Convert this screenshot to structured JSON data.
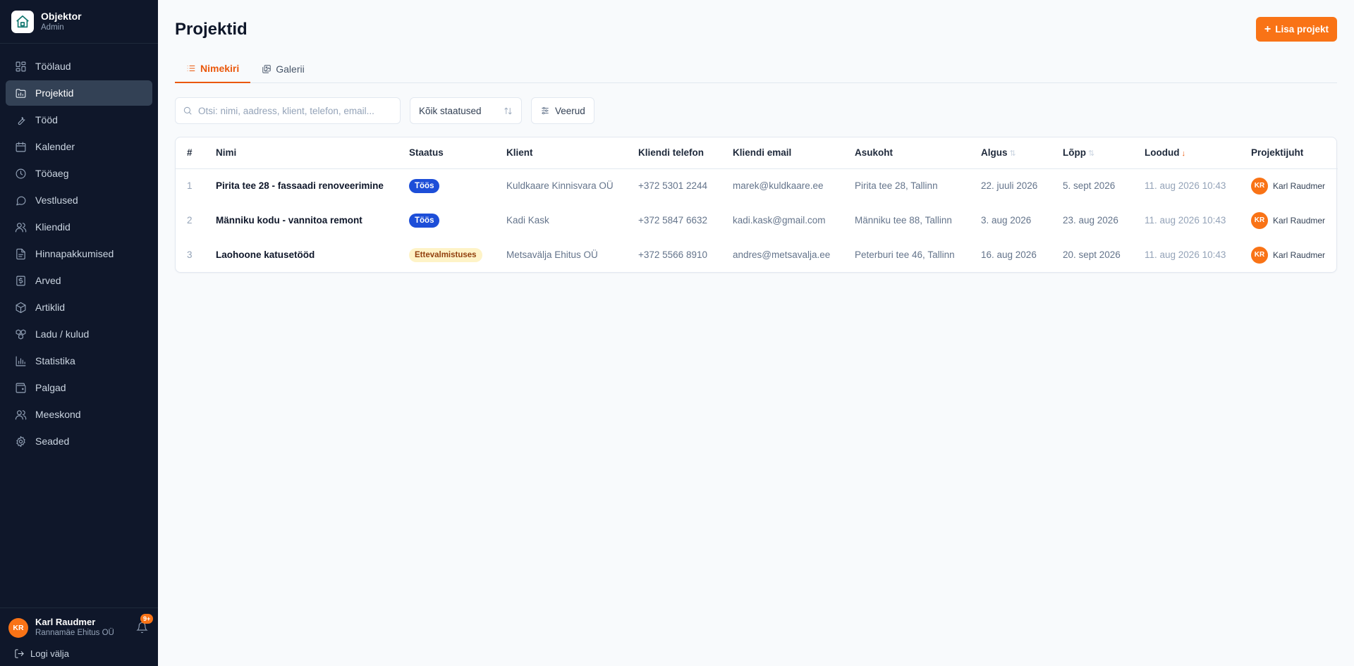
{
  "brand": {
    "name": "Objektor",
    "role": "Admin"
  },
  "nav": [
    {
      "label": "Töölaud",
      "icon": "dashboard-icon"
    },
    {
      "label": "Projektid",
      "icon": "folder-chart-icon"
    },
    {
      "label": "Tööd",
      "icon": "wrench-icon"
    },
    {
      "label": "Kalender",
      "icon": "calendar-icon"
    },
    {
      "label": "Tööaeg",
      "icon": "clock-icon"
    },
    {
      "label": "Vestlused",
      "icon": "chat-icon"
    },
    {
      "label": "Kliendid",
      "icon": "users-icon"
    },
    {
      "label": "Hinnapakkumised",
      "icon": "document-icon"
    },
    {
      "label": "Arved",
      "icon": "invoice-icon"
    },
    {
      "label": "Artiklid",
      "icon": "package-icon"
    },
    {
      "label": "Ladu / kulud",
      "icon": "boxes-icon"
    },
    {
      "label": "Statistika",
      "icon": "bar-chart-icon"
    },
    {
      "label": "Palgad",
      "icon": "wallet-icon"
    },
    {
      "label": "Meeskond",
      "icon": "team-icon"
    },
    {
      "label": "Seaded",
      "icon": "gear-icon"
    }
  ],
  "user": {
    "initials": "KR",
    "name": "Karl Raudmer",
    "company": "Rannamäe Ehitus OÜ",
    "notifications": "9+"
  },
  "logout_label": "Logi välja",
  "page": {
    "title": "Projektid",
    "add_label": "Lisa projekt"
  },
  "tabs": [
    {
      "label": "Nimekiri"
    },
    {
      "label": "Galerii"
    }
  ],
  "filters": {
    "search_placeholder": "Otsi: nimi, aadress, klient, telefon, email...",
    "status_value": "Kõik staatused",
    "columns_label": "Veerud"
  },
  "table": {
    "headers": {
      "num": "#",
      "name": "Nimi",
      "status": "Staatus",
      "client": "Klient",
      "phone": "Kliendi telefon",
      "email": "Kliendi email",
      "location": "Asukoht",
      "start": "Algus",
      "end": "Lõpp",
      "created": "Loodud",
      "pm": "Projektijuht"
    },
    "rows": [
      {
        "num": "1",
        "name": "Pirita tee 28 - fassaadi renoveerimine",
        "status": "Töös",
        "client": "Kuldkaare Kinnisvara OÜ",
        "phone": "+372 5301 2244",
        "email": "marek@kuldkaare.ee",
        "location": "Pirita tee 28, Tallinn",
        "start": "22. juuli 2026",
        "end": "5. sept 2026",
        "created": "11. aug 2026 10:43",
        "pm_initials": "KR",
        "pm": "Karl Raudmer"
      },
      {
        "num": "2",
        "name": "Männiku kodu - vannitoa remont",
        "status": "Töös",
        "client": "Kadi Kask",
        "phone": "+372 5847 6632",
        "email": "kadi.kask@gmail.com",
        "location": "Männiku tee 88, Tallinn",
        "start": "3. aug 2026",
        "end": "23. aug 2026",
        "created": "11. aug 2026 10:43",
        "pm_initials": "KR",
        "pm": "Karl Raudmer"
      },
      {
        "num": "3",
        "name": "Laohoone katusetööd",
        "status": "Ettevalmistuses",
        "client": "Metsavälja Ehitus OÜ",
        "phone": "+372 5566 8910",
        "email": "andres@metsavalja.ee",
        "location": "Peterburi tee 46, Tallinn",
        "start": "16. aug 2026",
        "end": "20. sept 2026",
        "created": "11. aug 2026 10:43",
        "pm_initials": "KR",
        "pm": "Karl Raudmer"
      }
    ]
  },
  "colors": {
    "accent": "#f97316",
    "sidebar_bg": "#0f172a",
    "status_active": "#1d4ed8",
    "status_prep": "#fef3c7"
  }
}
